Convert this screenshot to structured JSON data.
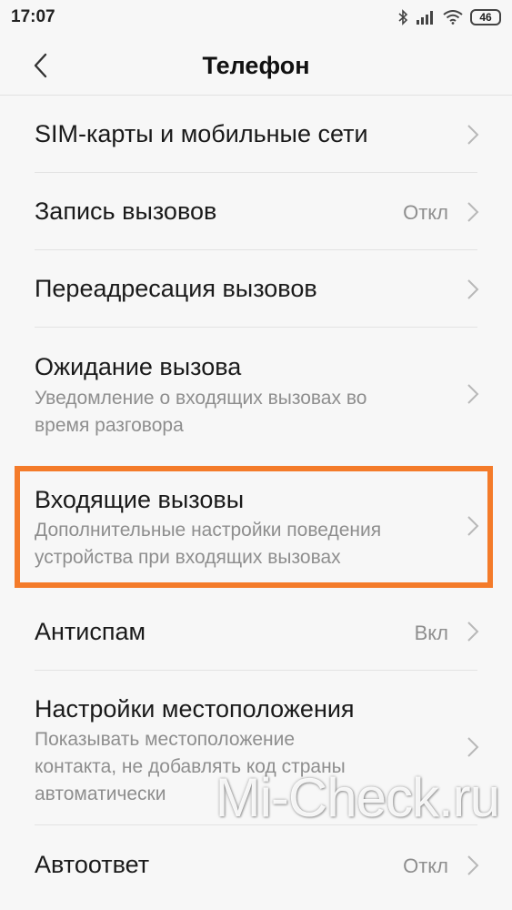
{
  "status_bar": {
    "time": "17:07",
    "battery": "46"
  },
  "header": {
    "title": "Телефон"
  },
  "items": [
    {
      "title": "SIM-карты и мобильные сети"
    },
    {
      "title": "Запись вызовов",
      "value": "Откл"
    },
    {
      "title": "Переадресация вызовов"
    },
    {
      "title": "Ожидание вызова",
      "sub1": "Уведомление о входящих вызовах во",
      "sub2": "время разговора"
    },
    {
      "title": "Входящие вызовы",
      "sub1": "Дополнительные настройки поведения",
      "sub2": "устройства при входящих вызовах"
    },
    {
      "title": "Антиспам",
      "value": "Вкл"
    },
    {
      "title": "Настройки местоположения",
      "sub1": "Показывать местоположение",
      "sub2": "контакта, не добавлять код страны",
      "sub3": "автоматически"
    },
    {
      "title": "Автоответ",
      "value": "Откл"
    }
  ],
  "highlight_color": "#f47b2a",
  "watermark": "Mi-Check.ru"
}
